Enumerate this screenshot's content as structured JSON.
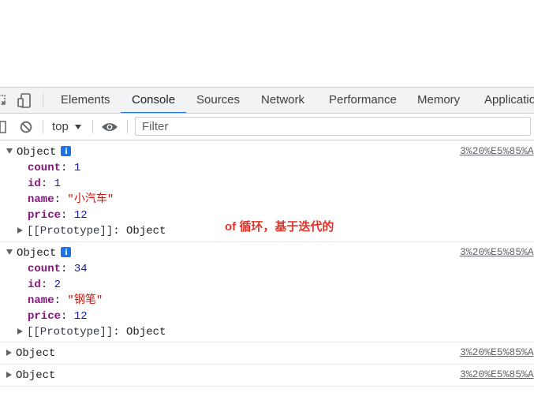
{
  "tabs": [
    {
      "label": "Elements"
    },
    {
      "label": "Console",
      "active": true
    },
    {
      "label": "Sources"
    },
    {
      "label": "Network"
    },
    {
      "label": "Performance"
    },
    {
      "label": "Memory"
    },
    {
      "label": "Applicatio"
    }
  ],
  "toolbar": {
    "context": "top",
    "filter_placeholder": "Filter"
  },
  "messages": [
    {
      "label": "Object",
      "source": "3%20%E5%85%A",
      "props": [
        {
          "key": "count",
          "value": "1"
        },
        {
          "key": "id",
          "value": "1"
        },
        {
          "key": "name",
          "value": "\"小汽车\""
        },
        {
          "key": "price",
          "value": "12"
        }
      ],
      "proto_key": "[[Prototype]]",
      "proto_value": "Object"
    },
    {
      "label": "Object",
      "source": "3%20%E5%85%A",
      "props": [
        {
          "key": "count",
          "value": "34"
        },
        {
          "key": "id",
          "value": "2"
        },
        {
          "key": "name",
          "value": "\"钢笔\""
        },
        {
          "key": "price",
          "value": "12"
        }
      ],
      "proto_key": "[[Prototype]]",
      "proto_value": "Object"
    },
    {
      "label": "Object",
      "source": "3%20%E5%85%A"
    },
    {
      "label": "Object",
      "source": "3%20%E5%85%A"
    }
  ],
  "annotation": "of 循环，基于迭代的",
  "colors": {
    "accent": "#1a73e8",
    "annotation": "#e0342b",
    "key": "#881280",
    "number": "#1a1aa6",
    "string": "#c41a16"
  }
}
